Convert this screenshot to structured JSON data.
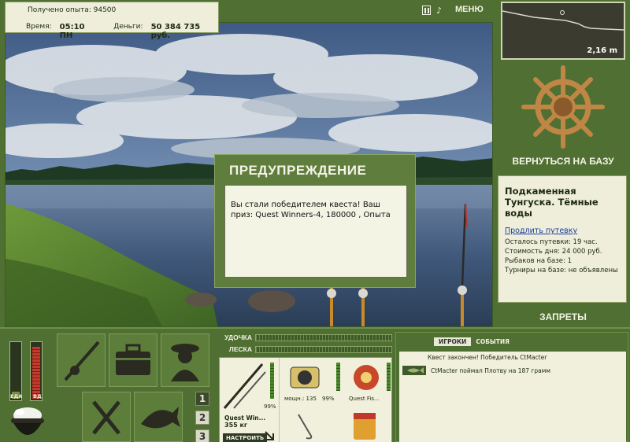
{
  "info": {
    "experience_label": "Получено опыта:",
    "experience_value": "94500",
    "time_label": "Время:",
    "time_value": "05:10 ПН",
    "money_label": "Деньги:",
    "money_value": "50 384 735 руб."
  },
  "topbar": {
    "menu_label": "МЕНЮ",
    "sound_glyph": "♪"
  },
  "depth": {
    "value": "2,16 m"
  },
  "warning": {
    "title": "ПРЕДУПРЕЖДЕНИЕ",
    "message": "Вы стали победителем квеста! Ваш приз: Quest Winners-4, 180000 , Опыта"
  },
  "base": {
    "return_label": "ВЕРНУТЬСЯ НА БАЗУ",
    "location_name": "Подкаменная Тунгуска. Тёмные воды",
    "extend_link": "Продлить путевку",
    "lines": [
      "Осталось путевки: 19 час.",
      "Стоимость дня: 24 000 руб.",
      "Рыбаков на базе: 1",
      "Турниры на базе: не объявлены"
    ],
    "bans_label": "ЗАПРЕТЫ"
  },
  "meters": {
    "food_label": "ЕДА",
    "vd_label": "ВД",
    "vd_level": 0.95,
    "food_level": 0.12
  },
  "buttons": {
    "num1": "1",
    "num2": "2",
    "num3": "3"
  },
  "bars": {
    "rod_label": "УДОЧКА",
    "line_label": "ЛЕСКА"
  },
  "tackle": {
    "rod_name": "Quest Win...",
    "rod_weight": "355 кг",
    "rod_pct": "99%",
    "setup_label": "НАСТРОИТЬ",
    "reel_power": "мощн.: 135",
    "reel_pct": "99%",
    "line_name": "Quest Fis..."
  },
  "events": {
    "tab_players": "ИГРОКИ",
    "tab_events": "СОБЫТИЯ",
    "items": [
      "Квест закончен! Победитель CtMacter",
      "CtMacter поймал Плотву на 187 грамм"
    ]
  }
}
